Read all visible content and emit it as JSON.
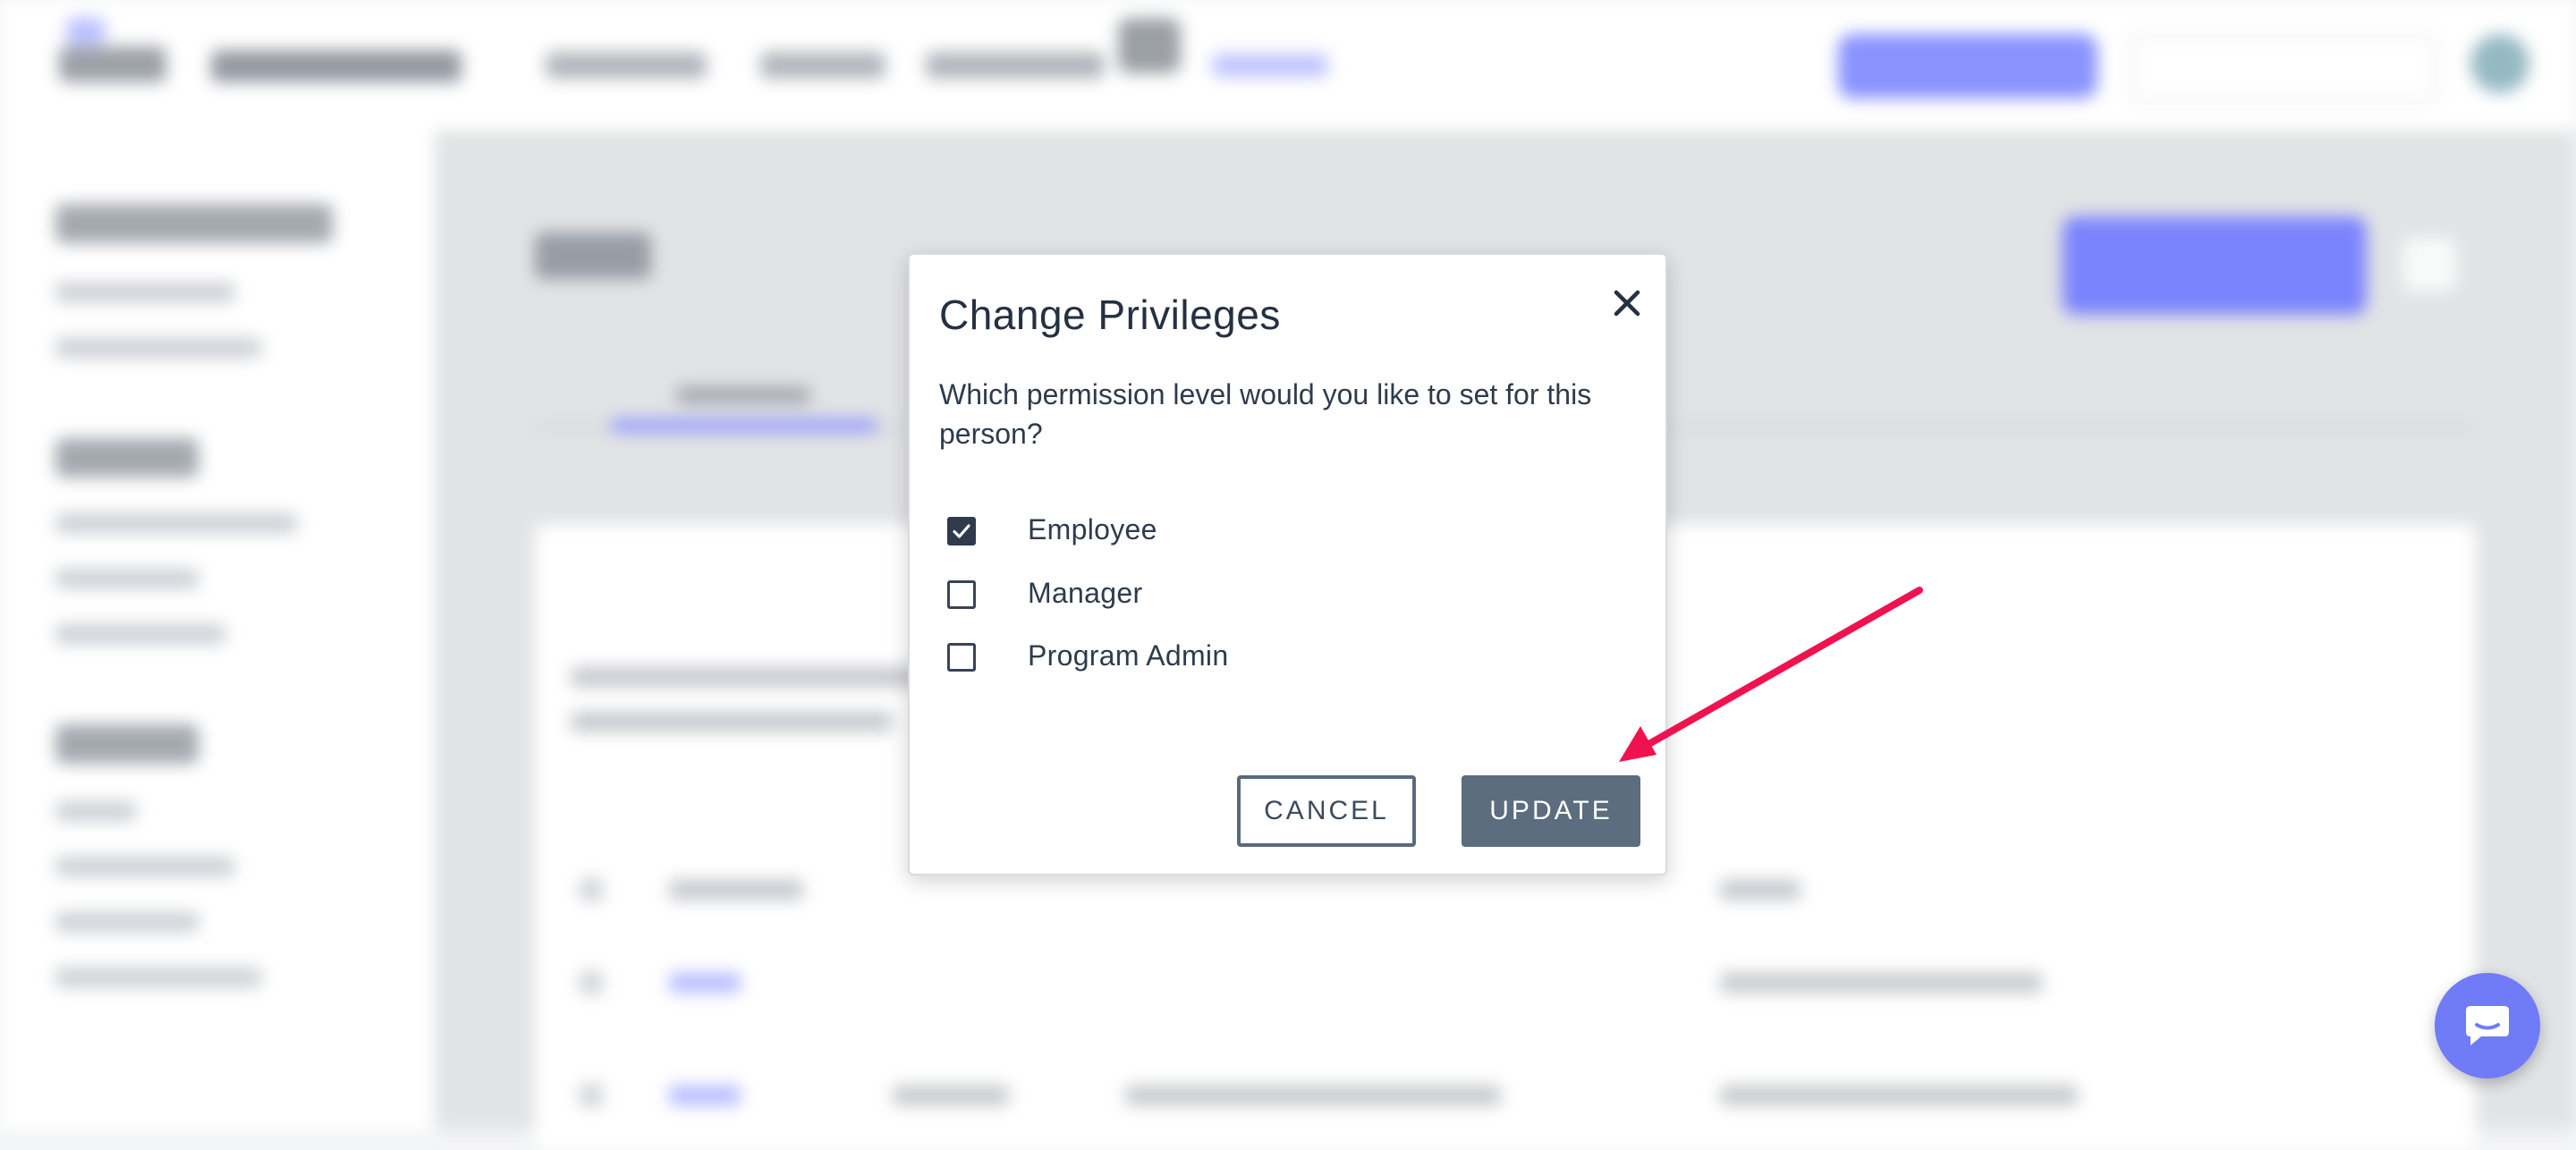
{
  "modal": {
    "title": "Change Privileges",
    "question": "Which permission level would you like to set for this person?",
    "options": [
      {
        "label": "Employee",
        "checked": true
      },
      {
        "label": "Manager",
        "checked": false
      },
      {
        "label": "Program Admin",
        "checked": false
      }
    ],
    "cancel_label": "CANCEL",
    "update_label": "UPDATE",
    "close_icon": "close-icon"
  },
  "colors": {
    "accent": "#6f7bf7",
    "update_button": "#5b6d7e",
    "annotation_arrow": "#f0124f",
    "text_dark": "#253041"
  },
  "icons": {
    "chat": "chat-bubble-icon",
    "checkbox_checked": "checkmark-icon"
  }
}
